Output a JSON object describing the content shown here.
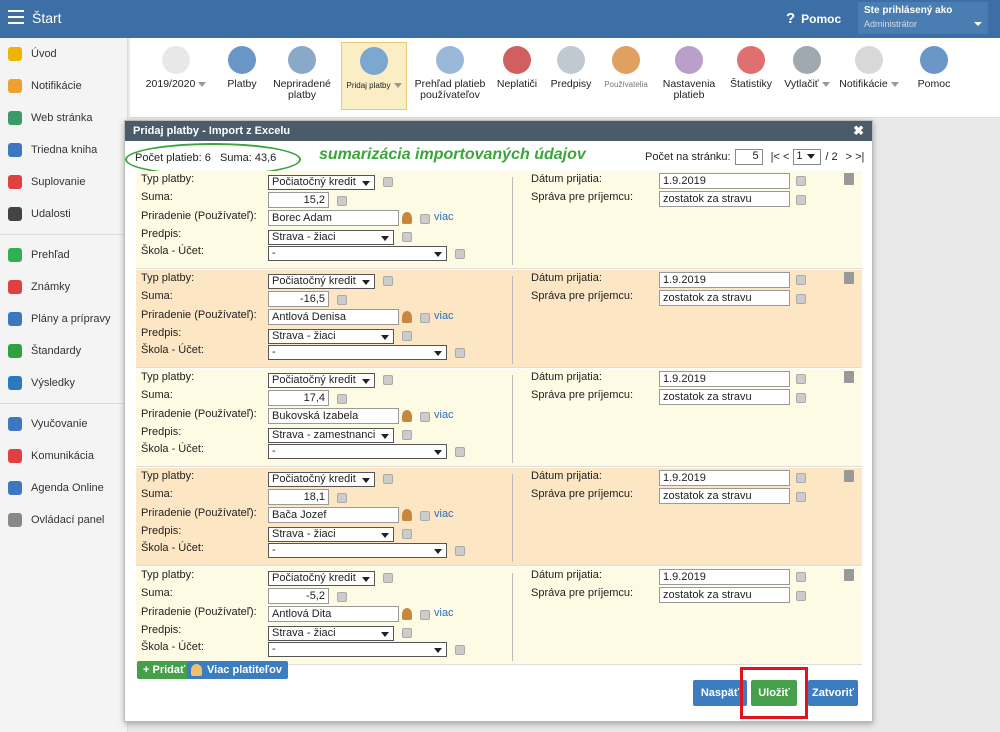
{
  "topbar": {
    "title": "Štart",
    "help": "Pomoc",
    "user_label": "Ste prihlásený ako",
    "user_role": "Administrátor"
  },
  "sidebar": {
    "items": [
      {
        "label": "Úvod",
        "icon": "star-icon",
        "color": "#f0b400"
      },
      {
        "label": "Notifikácie",
        "icon": "envelope-icon",
        "color": "#f0a030"
      },
      {
        "label": "Web stránka",
        "icon": "home-icon",
        "color": "#3a9a6a"
      },
      {
        "label": "Triedna kniha",
        "icon": "book-icon",
        "color": "#3b78c0"
      },
      {
        "label": "Suplovanie",
        "icon": "person-icon",
        "color": "#e04040"
      },
      {
        "label": "Udalosti",
        "icon": "calendar-icon",
        "color": "#444444"
      },
      {
        "label": "Prehľad",
        "icon": "check-circle-icon",
        "color": "#30b050"
      },
      {
        "label": "Známky",
        "icon": "grade-icon",
        "color": "#e04040"
      },
      {
        "label": "Plány a prípravy",
        "icon": "briefcase-icon",
        "color": "#3b78c0"
      },
      {
        "label": "Štandardy",
        "icon": "shield-icon",
        "color": "#30a040"
      },
      {
        "label": "Výsledky",
        "icon": "bar-chart-icon",
        "color": "#2a7ac0"
      },
      {
        "label": "Vyučovanie",
        "icon": "open-book-icon",
        "color": "#3b78c0"
      },
      {
        "label": "Komunikácia",
        "icon": "chat-icon",
        "color": "#e04040"
      },
      {
        "label": "Agenda Online",
        "icon": "pen-icon",
        "color": "#3b78c0"
      },
      {
        "label": "Ovládací panel",
        "icon": "gear-icon",
        "color": "#888888"
      }
    ]
  },
  "toolbar": {
    "items": [
      {
        "label": "2019/2020",
        "icon": "calendar-icon"
      },
      {
        "label": "Platby",
        "icon": "money-bag-icon"
      },
      {
        "label": "Nepriradené platby",
        "icon": "question-bag-icon"
      },
      {
        "label": "Pridaj platby",
        "icon": "add-bag-icon"
      },
      {
        "label": "Prehľad platieb používateľov",
        "icon": "euro-book-icon"
      },
      {
        "label": "Neplatiči",
        "icon": "clock-bag-icon"
      },
      {
        "label": "Predpisy",
        "icon": "document-icon"
      },
      {
        "label": "Používatelia",
        "icon": "user-icon"
      },
      {
        "label": "Nastavenia platieb",
        "icon": "gear-icon"
      },
      {
        "label": "Štatistiky",
        "icon": "pie-chart-icon"
      },
      {
        "label": "Vytlačiť",
        "icon": "printer-icon"
      },
      {
        "label": "Notifikácie",
        "icon": "phone-icon"
      },
      {
        "label": "Pomoc",
        "icon": "help-icon"
      }
    ]
  },
  "dialog": {
    "title": "Pridaj platby - Import z Excelu",
    "close": "✖",
    "count_label": "Počet platieb:",
    "count": "6",
    "sum_label": "Suma:",
    "sum": "43,6",
    "annotation": "sumarizácia importovaných údajov",
    "per_page_label": "Počet na stránku:",
    "per_page": "5",
    "page_prev": "|< <",
    "page": "1",
    "page_total": "/ 2",
    "page_next": "> >|"
  },
  "labels": {
    "type": "Typ platby:",
    "amount": "Suma:",
    "assign": "Priradenie (Používateľ):",
    "rule": "Predpis:",
    "account": "Škola - Účet:",
    "date": "Dátum prijatia:",
    "message": "Správa pre príjemcu:",
    "more": "viac"
  },
  "records": [
    {
      "type": "Počiatočný kredit",
      "amount": "15,2",
      "user": "Borec Adam",
      "rule": "Strava - žiaci",
      "account": "-",
      "date": "1.9.2019",
      "message": "zostatok za stravu"
    },
    {
      "type": "Počiatočný kredit",
      "amount": "-16,5",
      "user": "Antlová Denisa",
      "rule": "Strava - žiaci",
      "account": "-",
      "date": "1.9.2019",
      "message": "zostatok za stravu"
    },
    {
      "type": "Počiatočný kredit",
      "amount": "17,4",
      "user": "Bukovská Izabela",
      "rule": "Strava - zamestnanci",
      "account": "-",
      "date": "1.9.2019",
      "message": "zostatok za stravu"
    },
    {
      "type": "Počiatočný kredit",
      "amount": "18,1",
      "user": "Bača Jozef",
      "rule": "Strava - žiaci",
      "account": "-",
      "date": "1.9.2019",
      "message": "zostatok za stravu"
    },
    {
      "type": "Počiatočný kredit",
      "amount": "-5,2",
      "user": "Antlová Dita",
      "rule": "Strava - žiaci",
      "account": "-",
      "date": "1.9.2019",
      "message": "zostatok za stravu"
    }
  ],
  "buttons": {
    "add": "+ Pridať",
    "more_payers": "Viac platiteľov",
    "back": "Naspäť",
    "save": "Uložiť",
    "close": "Zatvoriť"
  }
}
